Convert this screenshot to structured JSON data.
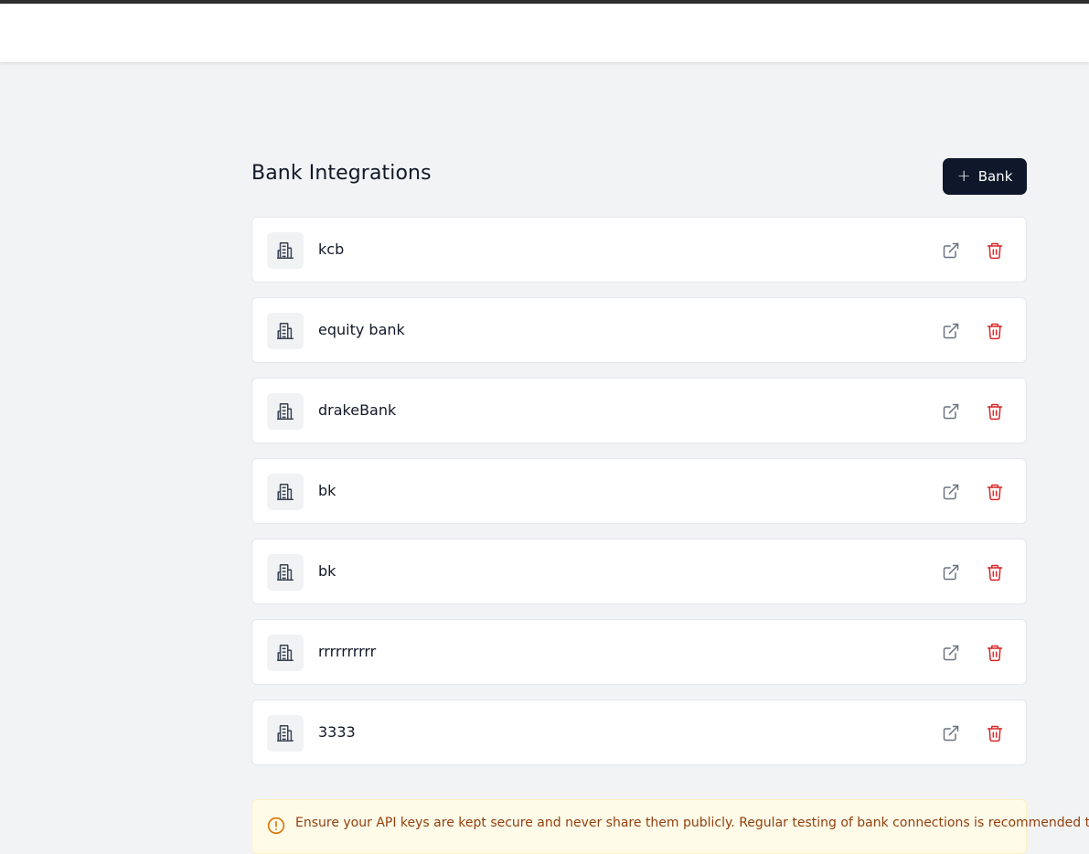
{
  "page": {
    "title": "Bank Integrations",
    "add_button_label": "Bank"
  },
  "banks": [
    {
      "name": "kcb"
    },
    {
      "name": "equity bank"
    },
    {
      "name": "drakeBank"
    },
    {
      "name": "bk"
    },
    {
      "name": "bk"
    },
    {
      "name": "rrrrrrrrrr"
    },
    {
      "name": "3333"
    }
  ],
  "notice": {
    "text": "Ensure your API keys are kept secure and never share them publicly. Regular testing of bank connections is recommended to"
  },
  "icons": {
    "bank": "building-icon",
    "open": "external-link-icon",
    "delete": "trash-icon",
    "add": "plus-icon",
    "notice": "alert-circle-icon"
  },
  "colors": {
    "primary_button": "#0f172a",
    "delete_icon": "#dc2626",
    "notice_bg": "#fefbe9",
    "notice_text": "#92400e"
  }
}
